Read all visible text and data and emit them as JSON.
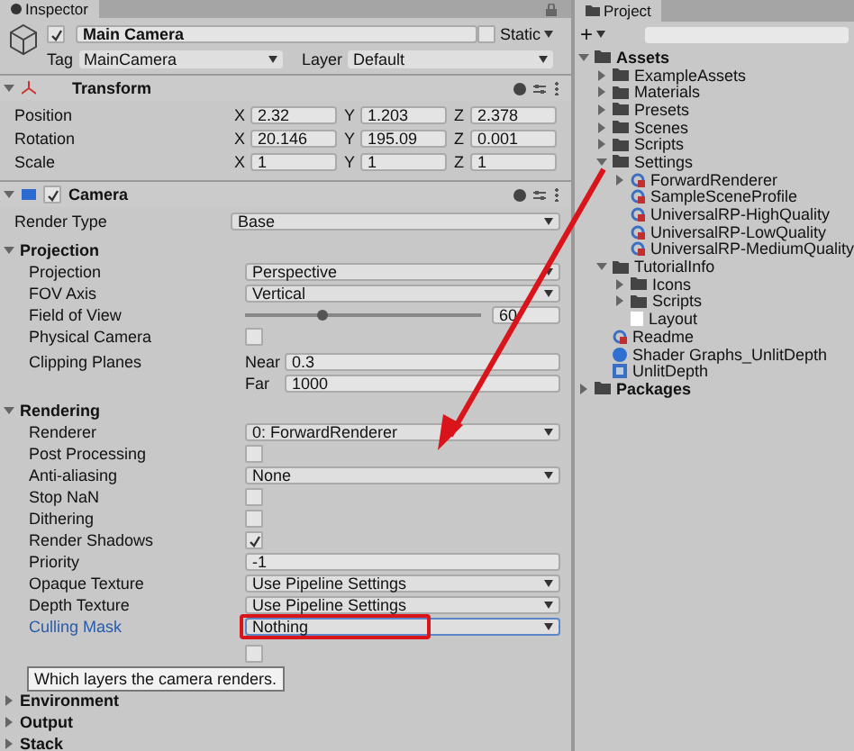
{
  "inspector": {
    "tab": "Inspector",
    "object": {
      "active": true,
      "name": "Main Camera",
      "static": false,
      "static_label": "Static",
      "tag_label": "Tag",
      "tag": "MainCamera",
      "layer_label": "Layer",
      "layer": "Default"
    },
    "transform": {
      "title": "Transform",
      "expanded": true,
      "rows": [
        {
          "label": "Position",
          "fields": [
            {
              "axis": "X",
              "value": "2.32"
            },
            {
              "axis": "Y",
              "value": "1.203"
            },
            {
              "axis": "Z",
              "value": "2.378"
            }
          ]
        },
        {
          "label": "Rotation",
          "fields": [
            {
              "axis": "X",
              "value": "20.146"
            },
            {
              "axis": "Y",
              "value": "195.09"
            },
            {
              "axis": "Z",
              "value": "0.001"
            }
          ]
        },
        {
          "label": "Scale",
          "fields": [
            {
              "axis": "X",
              "value": "1"
            },
            {
              "axis": "Y",
              "value": "1"
            },
            {
              "axis": "Z",
              "value": "1"
            }
          ]
        }
      ]
    },
    "camera": {
      "title": "Camera",
      "expanded": true,
      "enabled": true,
      "rows": [
        {
          "kind": "dropdown",
          "label": "Render Type",
          "value": "Base"
        }
      ],
      "sections": [
        {
          "title": "Projection",
          "expanded": true,
          "rows": [
            {
              "kind": "dropdown",
              "label": "Projection",
              "value": "Perspective"
            },
            {
              "kind": "dropdown",
              "label": "FOV Axis",
              "value": "Vertical"
            },
            {
              "kind": "slider",
              "label": "Field of View",
              "level": 0.33,
              "value": "60"
            },
            {
              "kind": "checkbox",
              "label": "Physical Camera",
              "checked": false
            },
            {
              "kind": "clip",
              "label": "Clipping Planes",
              "fields": [
                {
                  "name": "Near",
                  "value": "0.3"
                },
                {
                  "name": "Far",
                  "value": "1000"
                }
              ]
            }
          ]
        },
        {
          "title": "Rendering",
          "expanded": true,
          "rows": [
            {
              "kind": "dropdown",
              "label": "Renderer",
              "value": "0: ForwardRenderer"
            },
            {
              "kind": "checkbox",
              "label": "Post Processing",
              "checked": false
            },
            {
              "kind": "dropdown",
              "label": "Anti-aliasing",
              "value": "None"
            },
            {
              "kind": "checkbox",
              "label": "Stop NaN",
              "checked": false
            },
            {
              "kind": "checkbox",
              "label": "Dithering",
              "checked": false
            },
            {
              "kind": "checkbox",
              "label": "Render Shadows",
              "checked": true
            },
            {
              "kind": "text",
              "label": "Priority",
              "value": "-1"
            },
            {
              "kind": "dropdown",
              "label": "Opaque Texture",
              "value": "Use Pipeline Settings"
            },
            {
              "kind": "dropdown",
              "label": "Depth Texture",
              "value": "Use Pipeline Settings"
            },
            {
              "kind": "dropdown",
              "label": "Culling Mask",
              "value": "Nothing",
              "hovered": true,
              "annotated": true
            },
            {
              "kind": "checkbox",
              "checked": false
            }
          ]
        },
        {
          "title": "Environment",
          "expanded": false
        },
        {
          "title": "Output",
          "expanded": false
        },
        {
          "title": "Stack",
          "expanded": false
        }
      ]
    },
    "tooltip": "Which layers the camera renders."
  },
  "project": {
    "tab": "Project",
    "add": "+",
    "tree": [
      {
        "kind": "folder",
        "name": "Assets",
        "expanded": true,
        "children": [
          {
            "kind": "folder",
            "name": "ExampleAssets",
            "expanded": false
          },
          {
            "kind": "folder",
            "name": "Materials",
            "expanded": false
          },
          {
            "kind": "folder",
            "name": "Presets",
            "expanded": false
          },
          {
            "kind": "folder",
            "name": "Scenes",
            "expanded": false
          },
          {
            "kind": "folder",
            "name": "Scripts",
            "expanded": false
          },
          {
            "kind": "folder",
            "name": "Settings",
            "expanded": true,
            "children": [
              {
                "kind": "profile",
                "name": "ForwardRenderer",
                "expanded": false
              },
              {
                "kind": "profile",
                "name": "SampleSceneProfile"
              },
              {
                "kind": "profile",
                "name": "UniversalRP-HighQuality"
              },
              {
                "kind": "profile",
                "name": "UniversalRP-LowQuality"
              },
              {
                "kind": "profile",
                "name": "UniversalRP-MediumQuality"
              }
            ]
          },
          {
            "kind": "folder",
            "name": "TutorialInfo",
            "expanded": true,
            "children": [
              {
                "kind": "folder",
                "name": "Icons",
                "expanded": false
              },
              {
                "kind": "folder",
                "name": "Scripts",
                "expanded": false
              },
              {
                "kind": "doc",
                "name": "Layout"
              }
            ]
          },
          {
            "kind": "profile",
            "name": "Readme"
          },
          {
            "kind": "shader",
            "name": "Shader Graphs_UnlitDepth"
          },
          {
            "kind": "mesh",
            "name": "UnlitDepth"
          }
        ]
      },
      {
        "kind": "folder",
        "name": "Packages",
        "expanded": false
      }
    ]
  }
}
